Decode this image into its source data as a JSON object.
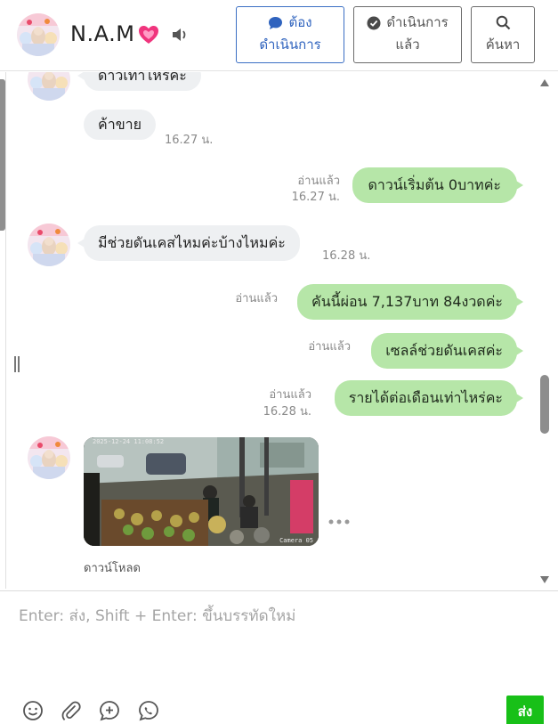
{
  "header": {
    "contact_name": "N.A.M",
    "buttons": {
      "todo": {
        "line1": "ต้อง",
        "line2": "ดำเนินการ"
      },
      "done": {
        "line1": "ดำเนินการ",
        "line2": "แล้ว"
      },
      "search": {
        "line1": "",
        "line2": "ค้นหา"
      }
    }
  },
  "messages": [
    {
      "direction": "in",
      "text": "ดาวเท่าไหร่คะ"
    },
    {
      "direction": "in",
      "text": "ค้าขาย",
      "time": "16.27 น."
    },
    {
      "direction": "out",
      "text": "ดาวน์เริ่มต้น 0บาทค่ะ",
      "read": "อ่านแล้ว",
      "time": "16.27 น."
    },
    {
      "direction": "in",
      "text": "มีช่วยดันเคสไหมค่ะบ้างไหมค่ะ",
      "time": "16.28 น."
    },
    {
      "direction": "out",
      "text": "คันนี้ผ่อน 7,137บาท 84งวดค่ะ",
      "read": "อ่านแล้ว"
    },
    {
      "direction": "out",
      "text": "เซลล์ช่วยดันเคสค่ะ",
      "read": "อ่านแล้ว"
    },
    {
      "direction": "out",
      "text": "รายได้ต่อเดือนเท่าไหร่คะ",
      "read": "อ่านแล้ว",
      "time": "16.28 น."
    }
  ],
  "image_message": {
    "stamp": "2025-12-24 11:08:52",
    "camera_label": "Camera 05",
    "download_label": "ดาวน์โหลด"
  },
  "composer": {
    "placeholder": "Enter: ส่ง, Shift + Enter: ขึ้นบรรทัดใหม่",
    "value": "",
    "send_label": "ส่ง"
  },
  "icons": {
    "heart": "sparkling-heart-icon",
    "speaker": "speaker-icon",
    "todo": "chat-bubble-icon",
    "done": "check-circle-icon",
    "search": "search-icon",
    "tools": [
      "emoji-icon",
      "paperclip-icon",
      "add-comment-icon",
      "phone-chat-icon"
    ]
  },
  "colors": {
    "outgoing_bubble": "#b6e6a8",
    "incoming_bubble": "#eef0f2",
    "send_button": "#18c018",
    "primary_button_border": "#3b6fc4"
  }
}
